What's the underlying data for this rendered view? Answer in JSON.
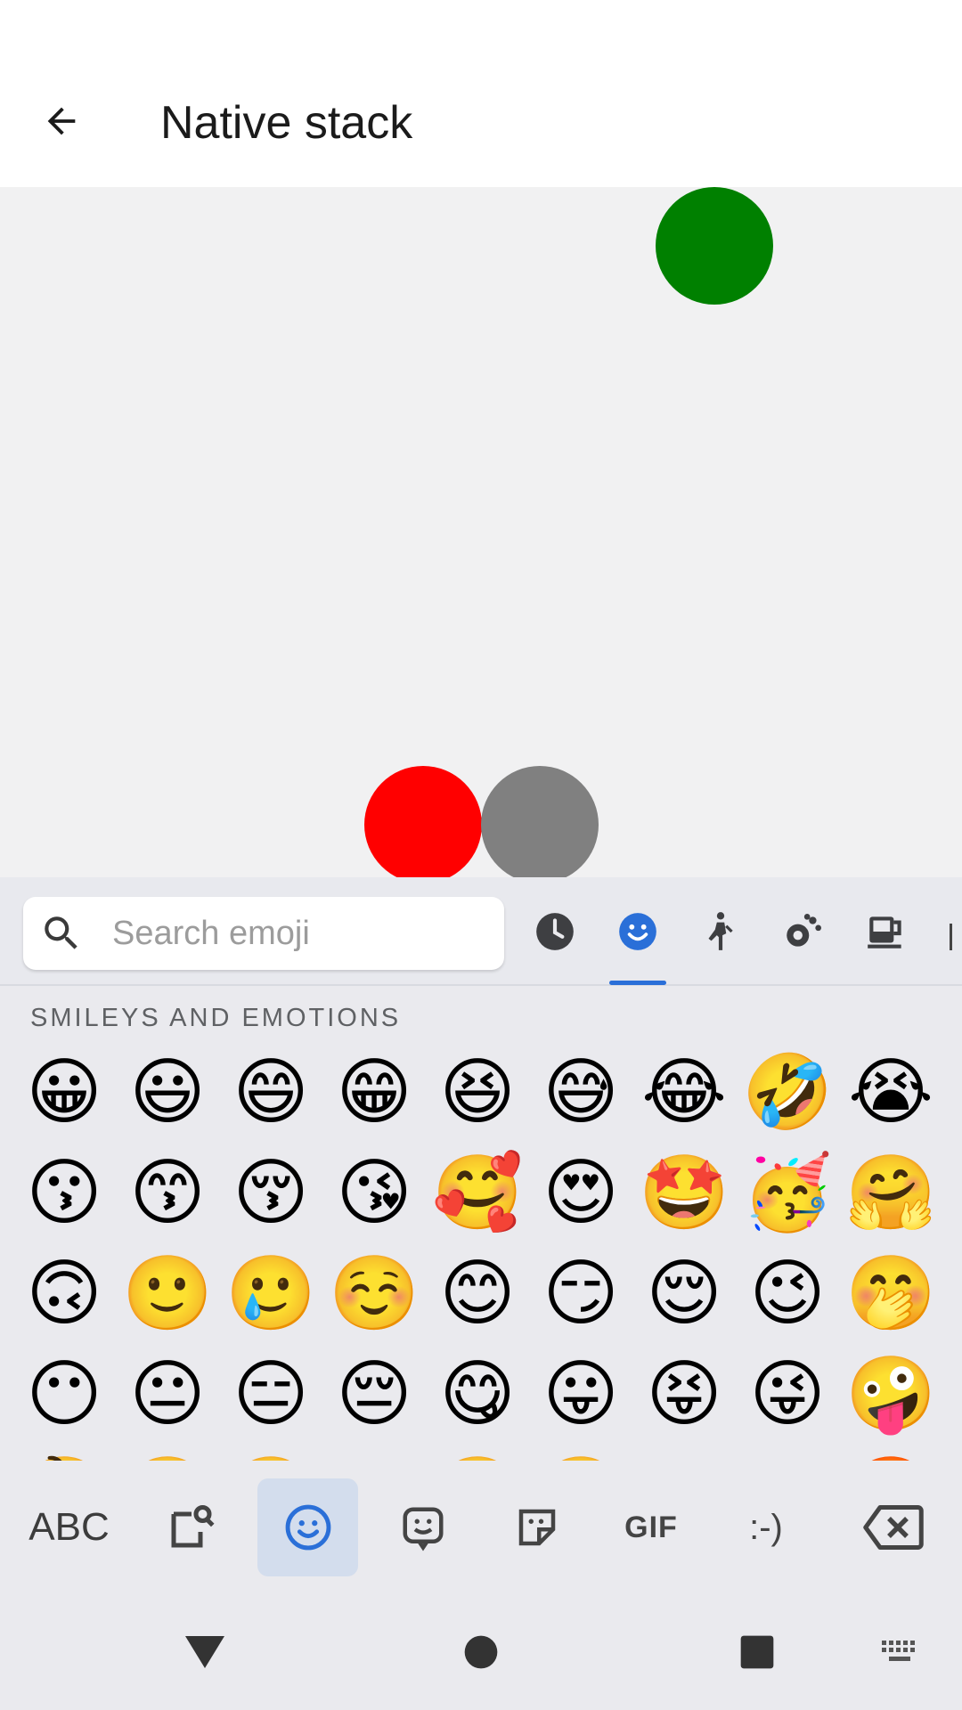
{
  "header": {
    "title": "Native stack",
    "back_icon": "arrow-left-icon"
  },
  "content": {
    "circles": [
      {
        "name": "green-circle",
        "color": "#008000"
      },
      {
        "name": "red-circle",
        "color": "#ff0000"
      },
      {
        "name": "gray-circle",
        "color": "#808080"
      }
    ]
  },
  "keyboard": {
    "search": {
      "placeholder": "Search emoji",
      "value": ""
    },
    "categories": [
      {
        "name": "recent",
        "icon": "clock-icon"
      },
      {
        "name": "smileys",
        "icon": "smiley-icon",
        "selected": true
      },
      {
        "name": "people",
        "icon": "person-walking-icon"
      },
      {
        "name": "animals",
        "icon": "bear-paw-icon"
      },
      {
        "name": "food",
        "icon": "cup-icon"
      }
    ],
    "section_title": "SMILEYS AND EMOTIONS",
    "emojis": [
      "😀",
      "😃",
      "😄",
      "😁",
      "😆",
      "😅",
      "😂",
      "🤣",
      "😭",
      "😗",
      "😙",
      "😚",
      "😘",
      "🥰",
      "😍",
      "🤩",
      "🥳",
      "🤗",
      "🙃",
      "🙂",
      "🥲",
      "☺️",
      "😊",
      "😏",
      "😌",
      "😉",
      "🤭",
      "😶",
      "😐",
      "😑",
      "😔",
      "😋",
      "😛",
      "😝",
      "😜",
      "🤪",
      "🤔",
      "🤨",
      "🧐",
      "😒",
      "🙄",
      "😤",
      "😠",
      "😡",
      "🤬"
    ],
    "bottom_bar": {
      "abc_label": "ABC",
      "gif_label": "GIF",
      "emoticon_label": ":-)"
    }
  },
  "accent_color": "#2a6fd8"
}
